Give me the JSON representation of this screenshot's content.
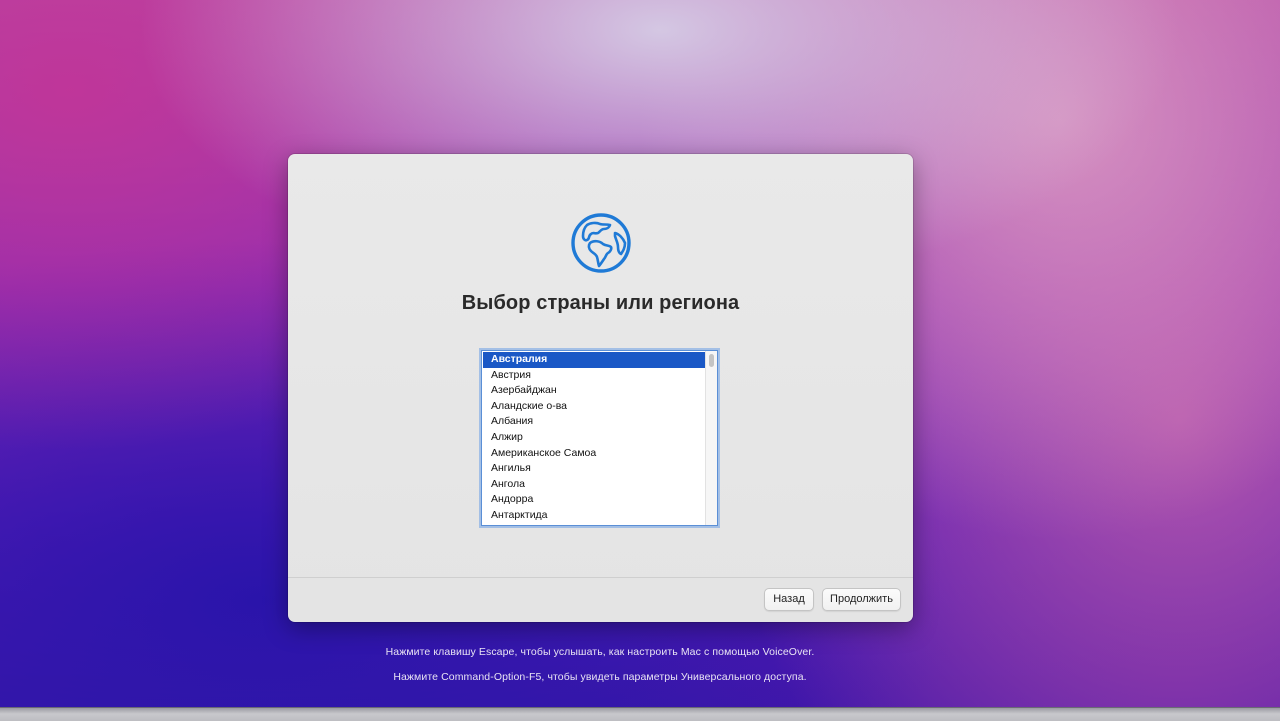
{
  "dialog": {
    "icon": "globe-icon",
    "title": "Выбор страны или региона",
    "countries": [
      "Австралия",
      "Австрия",
      "Азербайджан",
      "Аландские о-ва",
      "Албания",
      "Алжир",
      "Американское Самоа",
      "Ангилья",
      "Ангола",
      "Андорра",
      "Антарктида"
    ],
    "selected_country": "Австралия",
    "back_label": "Назад",
    "continue_label": "Продолжить"
  },
  "hints": {
    "voiceover": "Нажмите клавишу Escape, чтобы услышать, как настроить Mac с помощью VoiceOver.",
    "accessibility": "Нажмите Command-Option-F5, чтобы увидеть параметры Универсального доступа."
  },
  "colors": {
    "accent": "#1a58c6",
    "globe": "#1f7ad6"
  }
}
